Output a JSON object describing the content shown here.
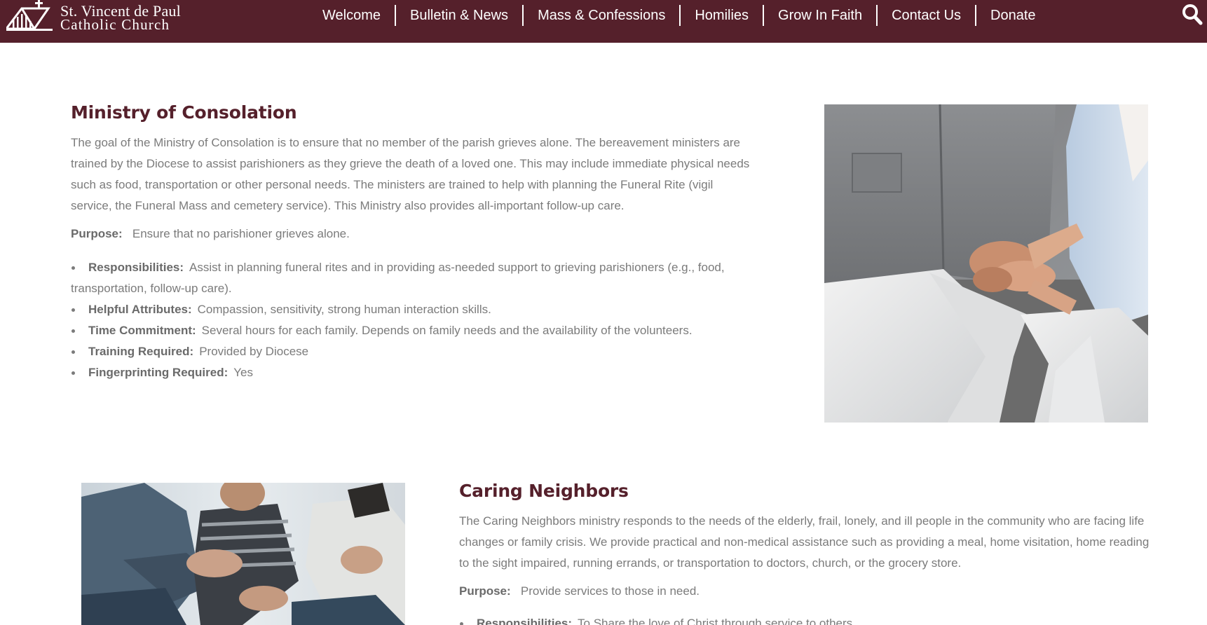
{
  "header": {
    "logo": {
      "line1": "St. Vincent de Paul",
      "line2": "Catholic Church",
      "icon": "church-icon"
    },
    "nav": [
      "Welcome",
      "Bulletin & News",
      "Mass & Confessions",
      "Homilies",
      "Grow In Faith",
      "Contact Us",
      "Donate"
    ],
    "search_icon": "search-icon"
  },
  "sections": [
    {
      "title": "Ministry of Consolation",
      "description": "The goal of the Ministry of Consolation is to ensure that no member of the parish grieves alone.  The bereavement ministers are trained by the Diocese to assist parishioners as they grieve the death of a loved one.  This may include immediate physical needs such as food, transportation or other personal needs.  The ministers are trained to help with planning the Funeral Rite (vigil service, the Funeral Mass and cemetery service).  This Ministry also provides all-important follow-up care.",
      "purpose_label": "Purpose:",
      "purpose": "Ensure that no parishioner grieves alone.",
      "details": [
        {
          "label": "Responsibilities:",
          "value": "Assist in planning funeral rites and in providing as-needed support to grieving parishioners (e.g., food, transportation, follow-up care)."
        },
        {
          "label": "Helpful Attributes:",
          "value": "Compassion, sensitivity, strong human interaction skills."
        },
        {
          "label": "Time Commitment:",
          "value": "Several hours for each family.  Depends on family needs and the availability of the volunteers."
        },
        {
          "label": "Training Required:",
          "value": "Provided by Diocese"
        },
        {
          "label": "Fingerprinting Required:",
          "value": "Yes"
        }
      ],
      "photo": "photo of two people seated holding hands"
    },
    {
      "title": "Caring Neighbors",
      "description": "The Caring Neighbors ministry responds to the needs of the elderly, frail, lonely, and ill people in the community who are facing life changes or family crisis. We provide practical and non-medical assistance such as providing a meal, home visitation, home reading to the sight impaired, running errands, or transportation to doctors, church, or the grocery store.",
      "purpose_label": "Purpose:",
      "purpose": "Provide services to those in need.",
      "details": [
        {
          "label": "Responsibilities:",
          "value": "To Share the love of Christ through service to others."
        }
      ],
      "photo": "photo of a group of people talking while seated"
    }
  ],
  "colors": {
    "brand": "#55202b",
    "body_text": "#7b7b7b"
  }
}
